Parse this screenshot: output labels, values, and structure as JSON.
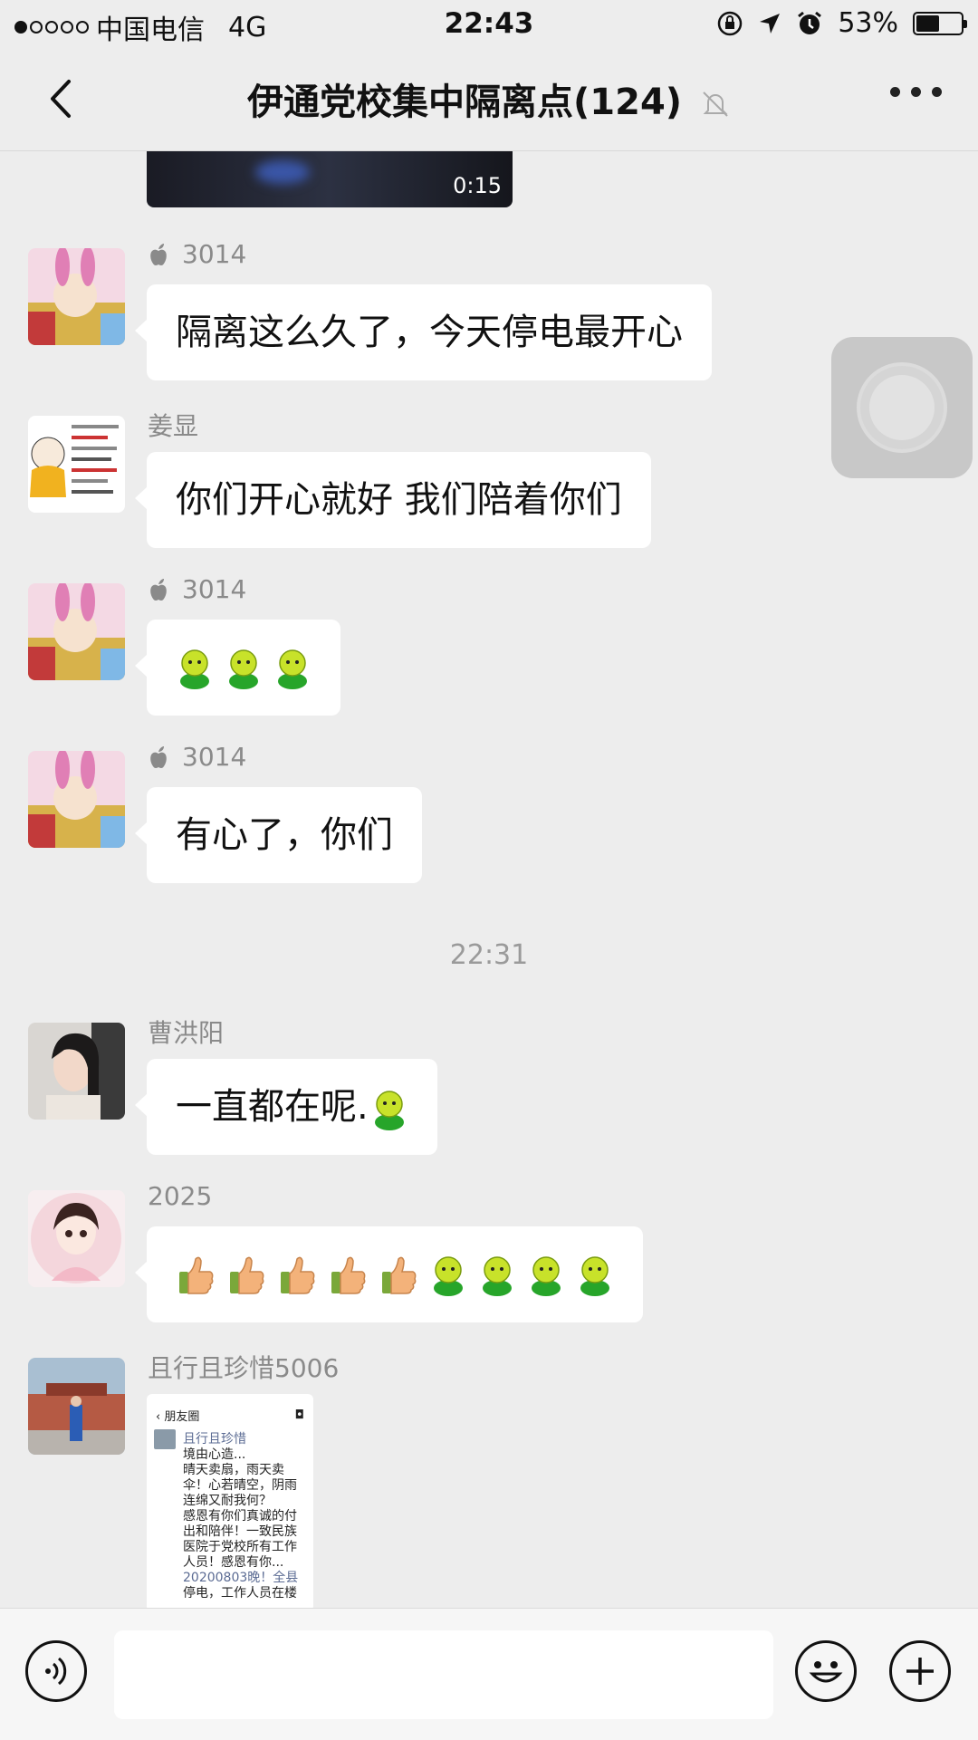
{
  "status_bar": {
    "carrier": "中国电信",
    "network": "4G",
    "time": "22:43",
    "battery_percent": "53%",
    "battery_level": 0.53,
    "signal_dots_filled": 1,
    "signal_dots_total": 5
  },
  "nav": {
    "title": "伊通党校集中隔离点(124)",
    "back_icon": "chevron-left-icon",
    "mute_icon": "bell-muted-icon",
    "more_icon": "more-dots-icon"
  },
  "video": {
    "duration": "0:15"
  },
  "messages": [
    {
      "sender": "3014",
      "sender_icon": "apple-icon",
      "text": "隔离这么久了，今天停电最开心"
    },
    {
      "sender": "姜显",
      "text": "你们开心就好 我们陪着你们"
    },
    {
      "sender": "3014",
      "sender_icon": "apple-icon",
      "emoji": [
        "smiley",
        "smiley",
        "smiley"
      ]
    },
    {
      "sender": "3014",
      "sender_icon": "apple-icon",
      "text": "有心了，你们"
    },
    {
      "sender": "曹洪阳",
      "text": "一直都在呢."
    },
    {
      "sender": "2025",
      "emoji": [
        "thumbs-up",
        "thumbs-up",
        "thumbs-up",
        "thumbs-up",
        "thumbs-up",
        "smiley",
        "smiley",
        "smiley",
        "smiley"
      ]
    },
    {
      "sender": "且行且珍惜5006"
    }
  ],
  "timestamp": "22:31",
  "shared_card": {
    "header": "朋友圈",
    "author": "且行且珍惜",
    "lines": [
      "境由心造...",
      "晴天卖扇，雨天卖",
      "伞！心若晴空，阴雨",
      "连绵又耐我何？",
      "感恩有你们真诚的付",
      "出和陪伴！一致民族",
      "医院于党校所有工作",
      "人员！感恩有你..."
    ],
    "link_line": "20200803晚！全县",
    "last_line": "停电，工作人员在楼"
  },
  "input_bar": {
    "voice_icon": "voice-icon",
    "emoji_icon": "emoji-icon",
    "plus_icon": "plus-icon"
  }
}
